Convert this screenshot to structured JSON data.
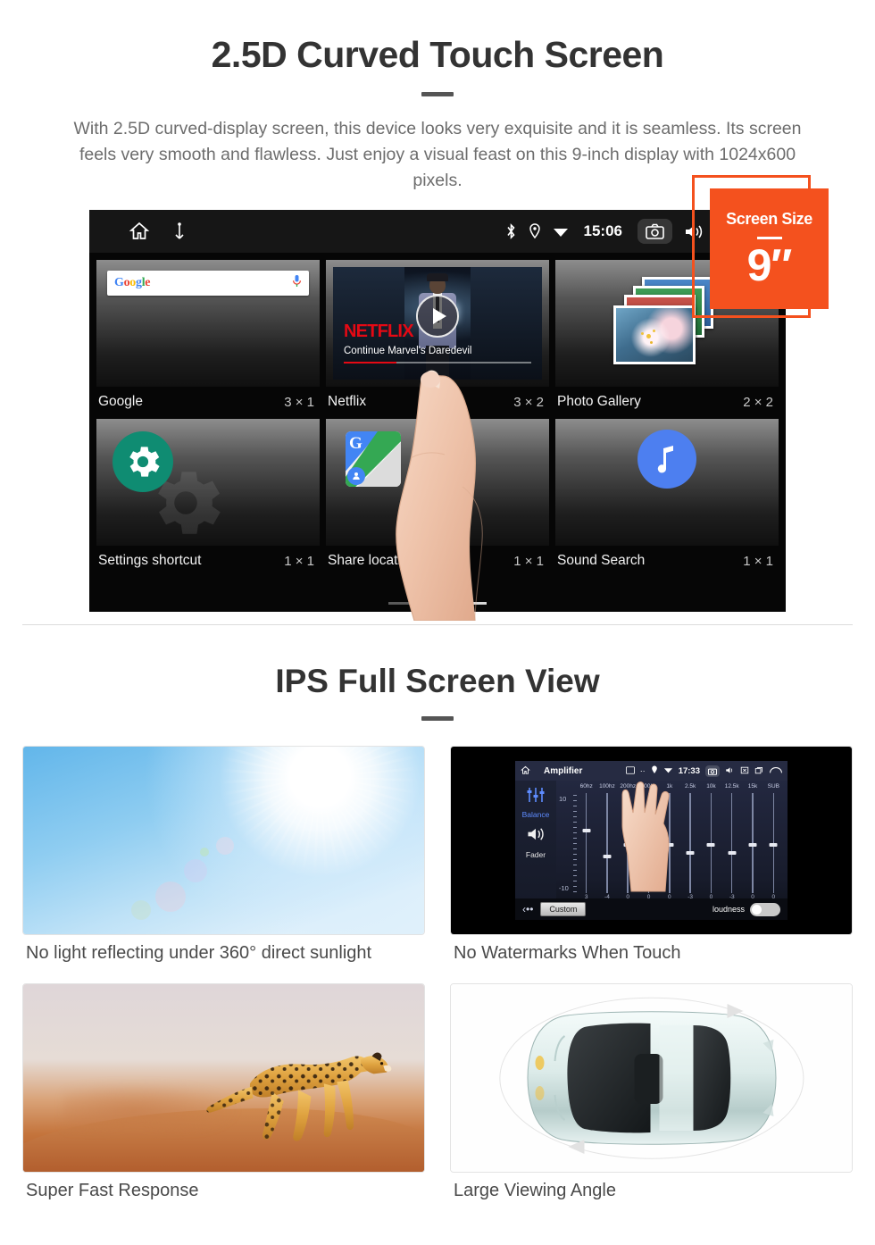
{
  "section1": {
    "title": "2.5D Curved Touch Screen",
    "description": "With 2.5D curved-display screen, this device looks very exquisite and it is seamless. Its screen feels very smooth and flawless. Just enjoy a visual feast on this 9-inch display with 1024x600 pixels.",
    "badge": {
      "title": "Screen Size",
      "value": "9″"
    },
    "accent_color": "#F4511E",
    "android": {
      "statusbar": {
        "time": "15:06",
        "left_icons": [
          "home-icon",
          "usb-icon"
        ],
        "right_icons": [
          "bluetooth-icon",
          "location-icon",
          "wifi-icon",
          "camera-icon",
          "volume-icon",
          "close-icon",
          "recents-icon"
        ]
      },
      "widgets": [
        {
          "name": "Google",
          "size": "3 × 1",
          "icon": "google-search-widget",
          "logo_letters": [
            "G",
            "o",
            "o",
            "g",
            "l",
            "e"
          ]
        },
        {
          "name": "Netflix",
          "size": "3 × 2",
          "icon": "netflix-widget",
          "brand": "NETFLIX",
          "caption": "Continue Marvel's Daredevil"
        },
        {
          "name": "Photo Gallery",
          "size": "2 × 2",
          "icon": "photo-gallery-widget"
        },
        {
          "name": "Settings shortcut",
          "size": "1 × 1",
          "icon": "gear-icon"
        },
        {
          "name": "Share location",
          "size": "1 × 1",
          "icon": "google-maps-icon"
        },
        {
          "name": "Sound Search",
          "size": "1 × 1",
          "icon": "music-note-icon"
        }
      ],
      "page_dots": 3,
      "active_dot": 3
    }
  },
  "section2": {
    "title": "IPS Full Screen View",
    "cards": [
      {
        "caption": "No light reflecting under 360° direct sunlight",
        "image": "sunlight-sky-photo"
      },
      {
        "caption": "No Watermarks When Touch",
        "image": "amplifier-screenshot"
      },
      {
        "caption": "Super Fast Response",
        "image": "running-cheetah-photo"
      },
      {
        "caption": "Large Viewing Angle",
        "image": "car-top-view-illustration"
      }
    ],
    "amplifier": {
      "title": "Amplifier",
      "time": "17:33",
      "sidebar": [
        {
          "label": "Balance",
          "icon": "sliders-icon",
          "active": true
        },
        {
          "label": "Fader",
          "icon": "speaker-icon",
          "active": false
        }
      ],
      "scale": {
        "top": "10",
        "mid": "0",
        "bottom": "-10"
      },
      "bands": [
        "60hz",
        "100hz",
        "200hz",
        "500hz",
        "1k",
        "2.5k",
        "10k",
        "12.5k",
        "15k",
        "SUB"
      ],
      "values": [
        "3",
        "-4",
        "0",
        "0",
        "0",
        "-3",
        "0",
        "-3",
        "0",
        "0"
      ],
      "preset_button": "Custom",
      "loudness_label": "loudness",
      "loudness_on": true,
      "back_icon": "back-arrow-icon"
    }
  }
}
